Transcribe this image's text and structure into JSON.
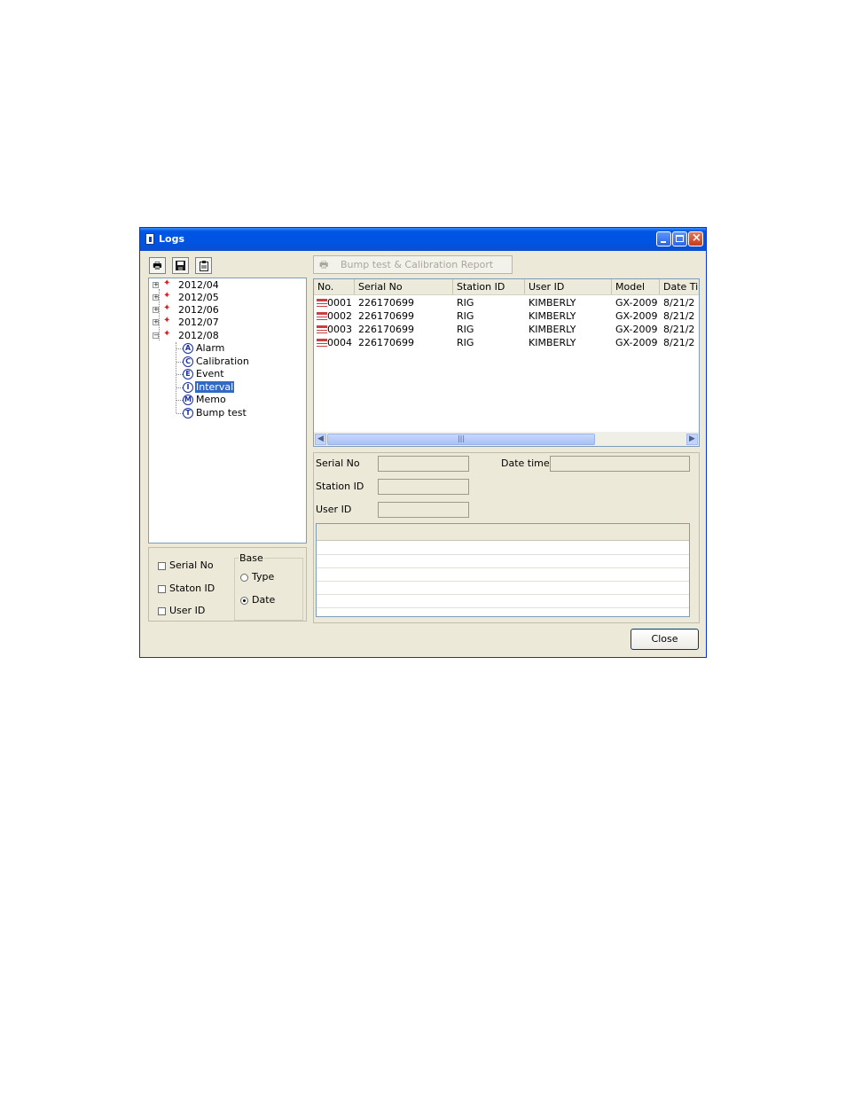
{
  "window": {
    "title": "Logs",
    "close_button": "Close"
  },
  "toolbar": {
    "report_button": "Bump test & Calibration Report",
    "icons": [
      "print-icon",
      "save-icon",
      "clipboard-icon"
    ]
  },
  "tree": {
    "months": [
      "2012/04",
      "2012/05",
      "2012/06",
      "2012/07",
      "2012/08"
    ],
    "children": [
      {
        "letter": "A",
        "label": "Alarm"
      },
      {
        "letter": "C",
        "label": "Calibration"
      },
      {
        "letter": "E",
        "label": "Event"
      },
      {
        "letter": "I",
        "label": "Interval",
        "selected": true
      },
      {
        "letter": "M",
        "label": "Memo"
      },
      {
        "letter": "T",
        "label": "Bump test"
      }
    ]
  },
  "filters": {
    "serial_no": "Serial No",
    "station_id": "Staton ID",
    "user_id": "User ID",
    "base_label": "Base",
    "type": "Type",
    "date": "Date",
    "selected_base": "Date"
  },
  "table": {
    "headers": [
      "No.",
      "Serial No",
      "Station ID",
      "User ID",
      "Model",
      "Date Ti"
    ],
    "rows": [
      [
        "0001",
        "226170699",
        "RIG",
        "KIMBERLY",
        "GX-2009",
        "8/21/2"
      ],
      [
        "0002",
        "226170699",
        "RIG",
        "KIMBERLY",
        "GX-2009",
        "8/21/2"
      ],
      [
        "0003",
        "226170699",
        "RIG",
        "KIMBERLY",
        "GX-2009",
        "8/21/2"
      ],
      [
        "0004",
        "226170699",
        "RIG",
        "KIMBERLY",
        "GX-2009",
        "8/21/2"
      ]
    ]
  },
  "detail": {
    "serial_no_label": "Serial No",
    "station_id_label": "Station ID",
    "user_id_label": "User ID",
    "date_time_label": "Date time"
  },
  "colors": {
    "titlebar": "#0054e3",
    "selection": "#316ac5",
    "month_marker": "#e21c1c"
  }
}
